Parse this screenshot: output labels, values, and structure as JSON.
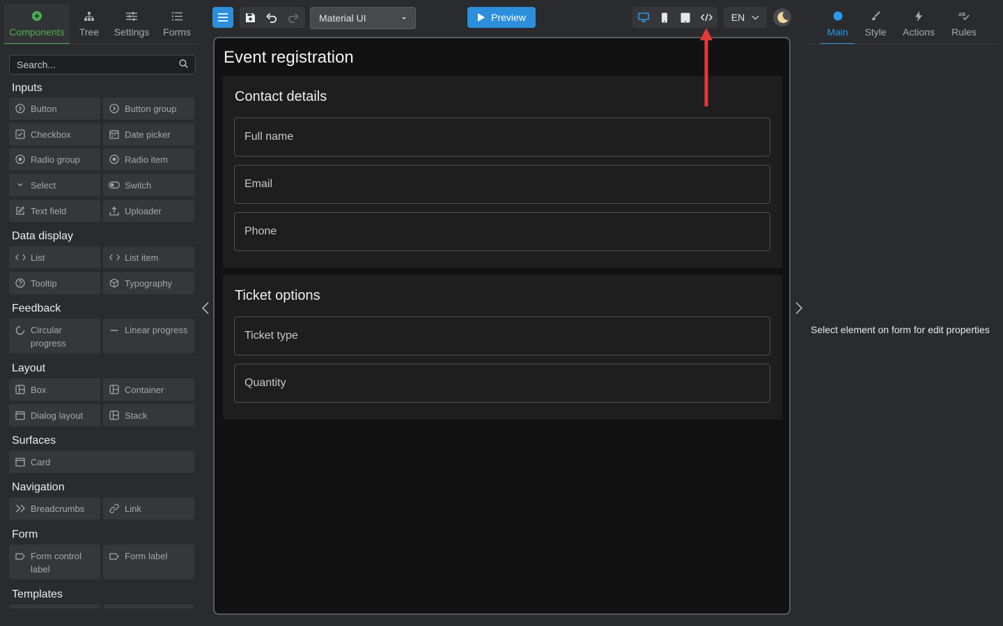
{
  "left_panel": {
    "tabs": [
      {
        "label": "Components",
        "icon": "plus-circle-icon",
        "active": true
      },
      {
        "label": "Tree",
        "icon": "tree-icon"
      },
      {
        "label": "Settings",
        "icon": "sliders-icon"
      },
      {
        "label": "Forms",
        "icon": "list-icon"
      }
    ],
    "search_placeholder": "Search...",
    "sections": {
      "inputs": {
        "title": "Inputs",
        "items": [
          "Button",
          "Button group",
          "Checkbox",
          "Date picker",
          "Radio group",
          "Radio item",
          "Select",
          "Switch",
          "Text field",
          "Uploader"
        ]
      },
      "data_display": {
        "title": "Data display",
        "items": [
          "List",
          "List item",
          "Tooltip",
          "Typography"
        ]
      },
      "feedback": {
        "title": "Feedback",
        "items": [
          "Circular progress",
          "Linear progress"
        ]
      },
      "layout": {
        "title": "Layout",
        "items": [
          "Box",
          "Container",
          "Dialog layout",
          "Stack"
        ]
      },
      "surfaces": {
        "title": "Surfaces",
        "items": [
          "Card"
        ]
      },
      "navigation": {
        "title": "Navigation",
        "items": [
          "Breadcrumbs",
          "Link"
        ]
      },
      "form": {
        "title": "Form",
        "items": [
          "Form control label",
          "Form label"
        ]
      },
      "templates": {
        "title": "Templates"
      }
    }
  },
  "toolbar": {
    "theme_select": "Material UI",
    "preview_label": "Preview",
    "language": "EN",
    "accent_color": "#2b8fdc"
  },
  "canvas": {
    "form_title": "Event registration",
    "cards": [
      {
        "title": "Contact details",
        "fields": [
          "Full name",
          "Email",
          "Phone"
        ]
      },
      {
        "title": "Ticket options",
        "fields": [
          "Ticket type",
          "Quantity"
        ]
      }
    ]
  },
  "right_panel": {
    "tabs": [
      {
        "label": "Main",
        "icon": "dot-icon",
        "active": true
      },
      {
        "label": "Style",
        "icon": "brush-icon"
      },
      {
        "label": "Actions",
        "icon": "lightning-icon"
      },
      {
        "label": "Rules",
        "icon": "rules-icon"
      }
    ],
    "empty_message": "Select element on form for edit properties"
  },
  "annotation": {
    "arrow_color": "#e53935",
    "points_to": "code-view-icon"
  }
}
